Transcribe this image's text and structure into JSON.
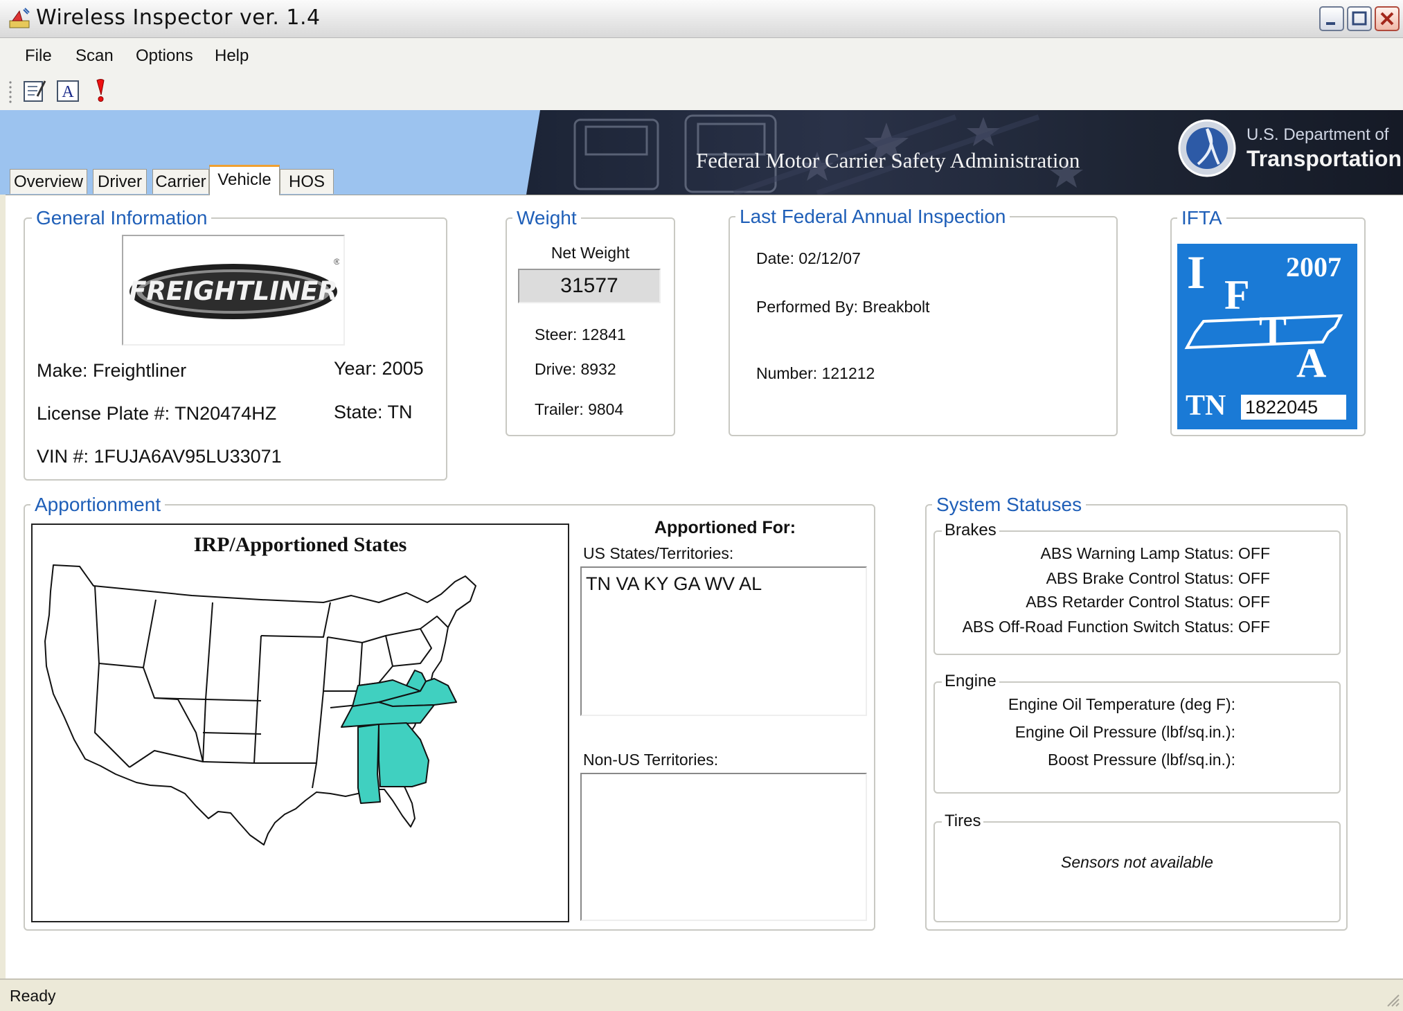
{
  "window": {
    "title": "Wireless Inspector ver. 1.4"
  },
  "menu": {
    "items": [
      "File",
      "Scan",
      "Options",
      "Help"
    ]
  },
  "toolbar": {
    "icons": [
      "edit-icon",
      "font-icon",
      "alert-icon"
    ]
  },
  "banner": {
    "agency": "Federal Motor Carrier Safety Administration",
    "dept_line1": "U.S. Department of",
    "dept_line2": "Transportation"
  },
  "tabs": [
    {
      "label": "Overview",
      "active": false
    },
    {
      "label": "Driver",
      "active": false
    },
    {
      "label": "Carrier",
      "active": false
    },
    {
      "label": "Vehicle",
      "active": true
    },
    {
      "label": "HOS",
      "active": false
    }
  ],
  "general": {
    "legend": "General Information",
    "logo_text": "FREIGHTLINER",
    "make": "Make: Freightliner",
    "year": "Year: 2005",
    "plate": "License Plate #: TN20474HZ",
    "state": "State: TN",
    "vin": "VIN #: 1FUJA6AV95LU33071"
  },
  "weight": {
    "legend": "Weight",
    "net_label": "Net Weight",
    "net_value": "31577",
    "steer": "Steer: 12841",
    "drive": "Drive: 8932",
    "trailer": "Trailer: 9804"
  },
  "inspection": {
    "legend": "Last Federal Annual Inspection",
    "date": "Date: 02/12/07",
    "performed_by": "Performed By: Breakbolt",
    "number": "Number: 121212"
  },
  "ifta": {
    "legend": "IFTA",
    "letter_i": "I",
    "letter_f": "F",
    "letter_t": "T",
    "letter_a": "A",
    "year": "2007",
    "state": "TN",
    "number": "1822045",
    "badge_color": "#1a7ad6"
  },
  "apportionment": {
    "legend": "Apportionment",
    "map_title": "IRP/Apportioned States",
    "apportioned_for": "Apportioned For:",
    "us_label": "US States/Territories:",
    "us_value": "TN VA KY GA WV AL",
    "nonus_label": "Non-US Territories:",
    "nonus_value": "",
    "highlight_color": "#40d0c0"
  },
  "system": {
    "legend": "System Statuses",
    "brakes_legend": "Brakes",
    "brakes": [
      "ABS Warning Lamp Status: OFF",
      "ABS Brake Control Status: OFF",
      "ABS Retarder Control Status: OFF",
      "ABS Off-Road Function Switch Status: OFF"
    ],
    "engine_legend": "Engine",
    "engine": [
      "Engine Oil Temperature (deg F):",
      "Engine Oil Pressure (lbf/sq.in.):",
      "Boost Pressure (lbf/sq.in.):"
    ],
    "tires_legend": "Tires",
    "tires_msg": "Sensors not available"
  },
  "status": {
    "text": "Ready"
  }
}
